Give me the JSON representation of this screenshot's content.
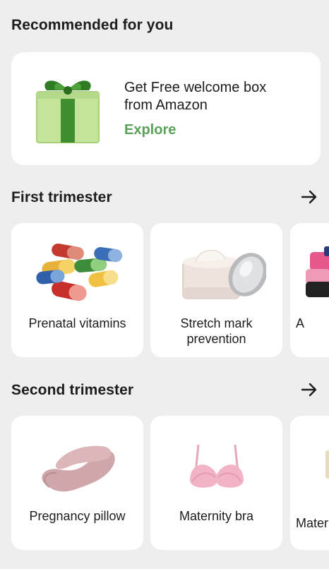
{
  "sections": {
    "recommended": {
      "title": "Recommended for you"
    },
    "first": {
      "title": "First trimester"
    },
    "second": {
      "title": "Second trimester"
    }
  },
  "promo": {
    "title": "Get Free welcome box from Amazon",
    "link": "Explore",
    "icon": "gift-box-icon"
  },
  "first_trimester_items": [
    {
      "label": "Prenatal vitamins",
      "icon": "capsules-icon"
    },
    {
      "label": "Stretch mark prevention",
      "icon": "cream-jar-icon"
    },
    {
      "label": "A",
      "icon": "pink-device-icon"
    }
  ],
  "second_trimester_items": [
    {
      "label": "Pregnancy pillow",
      "icon": "pregnancy-pillow-icon"
    },
    {
      "label": "Maternity bra",
      "icon": "bra-icon"
    },
    {
      "label": "Mater",
      "icon": "maternity-item-icon"
    }
  ],
  "colors": {
    "background": "#eeeeee",
    "card": "#ffffff",
    "accent_green": "#5aa05a",
    "text": "#1c1c1c"
  }
}
